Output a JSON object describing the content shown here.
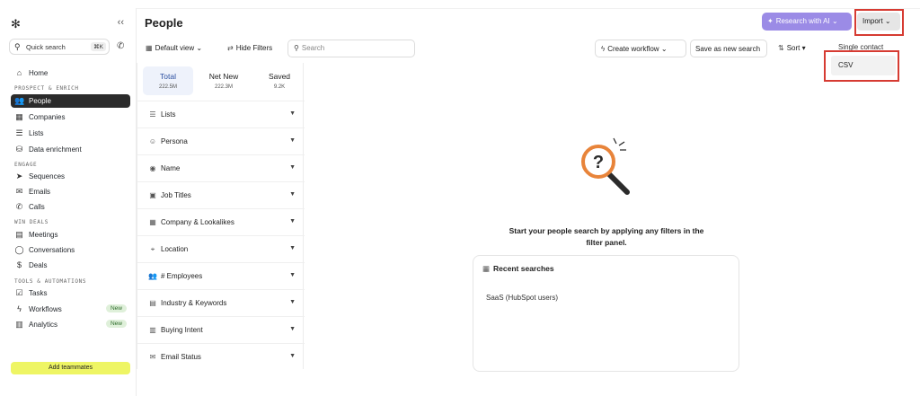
{
  "sidebar": {
    "logo": "✻",
    "collapse": "‹‹",
    "quick_search": {
      "label": "Quick search",
      "shortcut": "⌘K"
    },
    "sections": {
      "prospect": "PROSPECT & ENRICH",
      "engage": "ENGAGE",
      "deals": "WIN DEALS",
      "tools": "TOOLS & AUTOMATIONS"
    },
    "items": [
      {
        "label": "Home",
        "icon": "⌂"
      },
      {
        "label": "People",
        "icon": "👥"
      },
      {
        "label": "Companies",
        "icon": "▦"
      },
      {
        "label": "Lists",
        "icon": "☰"
      },
      {
        "label": "Data enrichment",
        "icon": "⛁"
      },
      {
        "label": "Sequences",
        "icon": "➤"
      },
      {
        "label": "Emails",
        "icon": "✉"
      },
      {
        "label": "Calls",
        "icon": "✆"
      },
      {
        "label": "Meetings",
        "icon": "▤"
      },
      {
        "label": "Conversations",
        "icon": "◯"
      },
      {
        "label": "Deals",
        "icon": "$"
      },
      {
        "label": "Tasks",
        "icon": "☑"
      },
      {
        "label": "Workflows",
        "icon": "ϟ",
        "badge": "New"
      },
      {
        "label": "Analytics",
        "icon": "▥",
        "badge": "New"
      }
    ],
    "add_button": "Add teammates"
  },
  "header": {
    "title": "People",
    "research_button": "Research with AI",
    "import_button": "Import"
  },
  "toolbar": {
    "default_view": "Default view",
    "hide_filters": "Hide Filters",
    "search_placeholder": "Search",
    "create_workflow": "Create workflow",
    "save_search": "Save as new search",
    "sort": "Sort"
  },
  "import_menu": {
    "single_contact": "Single contact",
    "csv": "CSV"
  },
  "filter_panel": {
    "tabs": [
      {
        "label": "Total",
        "count": "222.5M"
      },
      {
        "label": "Net New",
        "count": "222.3M"
      },
      {
        "label": "Saved",
        "count": "9.2K"
      }
    ],
    "filters": [
      {
        "label": "Lists",
        "icon": "☰"
      },
      {
        "label": "Persona",
        "icon": "☺"
      },
      {
        "label": "Name",
        "icon": "◉"
      },
      {
        "label": "Job Titles",
        "icon": "▣"
      },
      {
        "label": "Company & Lookalikes",
        "icon": "▦"
      },
      {
        "label": "Location",
        "icon": "⌖"
      },
      {
        "label": "# Employees",
        "icon": "👥"
      },
      {
        "label": "Industry & Keywords",
        "icon": "▤"
      },
      {
        "label": "Buying Intent",
        "icon": "▥"
      },
      {
        "label": "Email Status",
        "icon": "✉"
      }
    ]
  },
  "empty_state": {
    "message": "Start your people search by applying any filters in the filter panel."
  },
  "recent_searches": {
    "title": "Recent searches",
    "items": [
      "SaaS (HubSpot users)"
    ]
  },
  "colors": {
    "accent": "#9b8be6",
    "highlight": "#d63b32",
    "add_button": "#eef564",
    "magnifier": "#e8843a"
  }
}
